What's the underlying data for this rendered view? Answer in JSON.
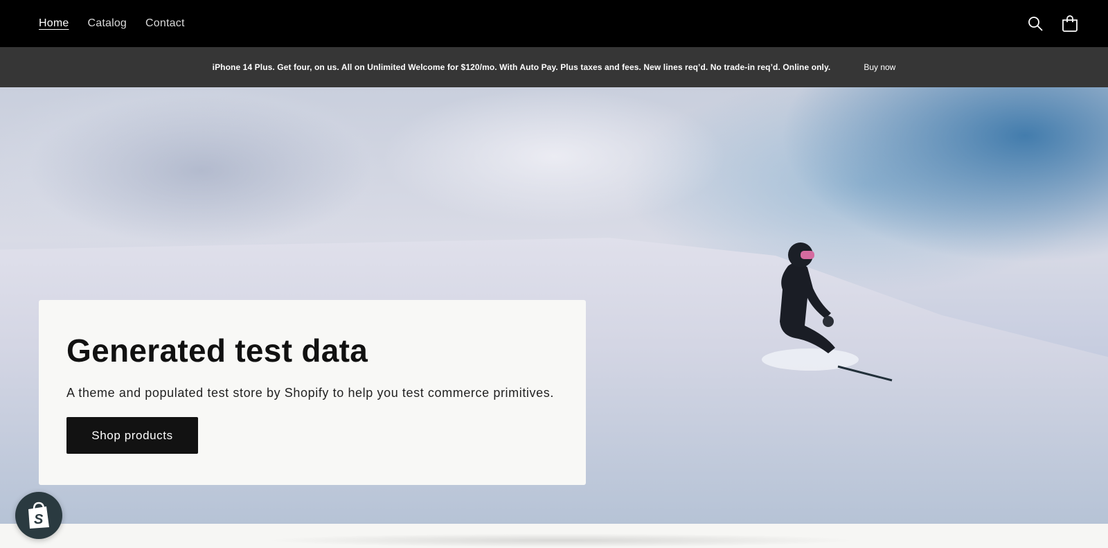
{
  "nav": {
    "links": [
      "Home",
      "Catalog",
      "Contact"
    ],
    "active": "Home",
    "icons": [
      "search-icon",
      "cart-icon"
    ]
  },
  "announcement": {
    "text": "iPhone 14 Plus. Get four, on us. All on Unlimited Welcome for $120/mo. With Auto Pay. Plus taxes and fees. New lines req’d. No trade-in req’d. Online only.",
    "link_label": "Buy now"
  },
  "hero": {
    "title": "Generated test data",
    "subtitle": "A theme and populated test store by Shopify to help you test commerce primitives.",
    "button_label": "Shop products"
  },
  "badge": {
    "icon": "shopify-bag-icon"
  },
  "colors": {
    "nav_bg": "#000000",
    "announce_bg": "#363636",
    "button_bg": "#121212",
    "card_bg": "#f8f8f6"
  }
}
